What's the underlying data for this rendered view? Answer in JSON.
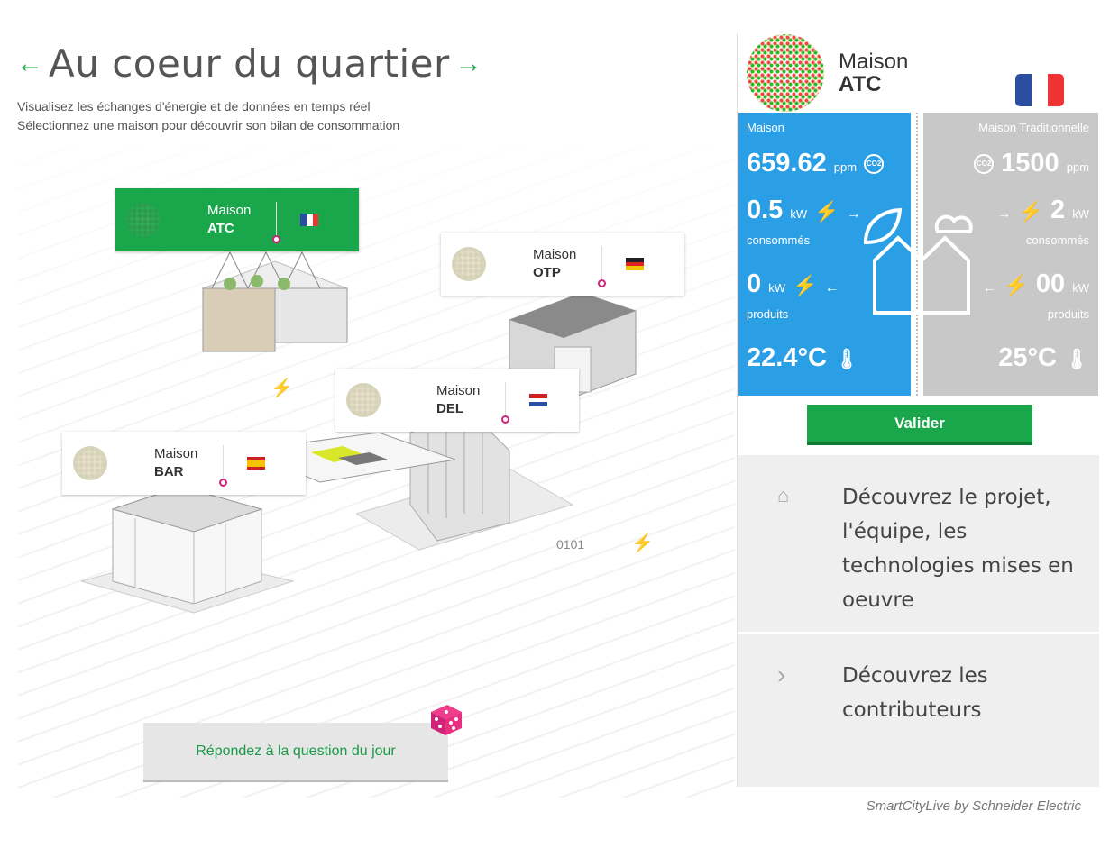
{
  "header": {
    "title": "Au coeur du quartier",
    "subtitle_line1": "Visualisez les échanges d'énergie et de données en temps réel",
    "subtitle_line2": "Sélectionnez une maison pour découvrir son bilan de consommation"
  },
  "houses": [
    {
      "label": "Maison",
      "name": "ATC",
      "flag": "france",
      "active": true
    },
    {
      "label": "Maison",
      "name": "OTP",
      "flag": "germany",
      "active": false
    },
    {
      "label": "Maison",
      "name": "DEL",
      "flag": "netherlands",
      "active": false
    },
    {
      "label": "Maison",
      "name": "BAR",
      "flag": "spain",
      "active": false
    }
  ],
  "scene": {
    "binary_label": "0101"
  },
  "question_button": "Répondez à la question du jour",
  "panel": {
    "title_label": "Maison",
    "title_name": "ATC",
    "left": {
      "header": "Maison",
      "co2": "659.62",
      "co2_unit": "ppm",
      "consumed": "0.5",
      "consumed_unit": "kW",
      "consumed_label": "consommés",
      "produced": "0",
      "produced_unit": "kW",
      "produced_label": "produits",
      "temperature": "22.4°C"
    },
    "right": {
      "header": "Maison Traditionnelle",
      "co2": "1500",
      "co2_unit": "ppm",
      "consumed": "2",
      "consumed_unit": "kW",
      "consumed_label": "consommés",
      "produced": "00",
      "produced_unit": "kW",
      "produced_label": "produits",
      "temperature": "25°C"
    },
    "co2_icon_text": "CO2",
    "valider": "Valider",
    "info1": "Découvrez le projet, l'équipe, les technologies mises en oeuvre",
    "info2": "Découvrez les contributeurs"
  },
  "footer": "SmartCityLive by Schneider Electric",
  "colors": {
    "accent_green": "#1aa64a",
    "panel_blue": "#2a9fe6",
    "panel_grey": "#c8c8c8",
    "dot_pink": "#d0237a",
    "bolt_yellow": "#c8d400"
  }
}
